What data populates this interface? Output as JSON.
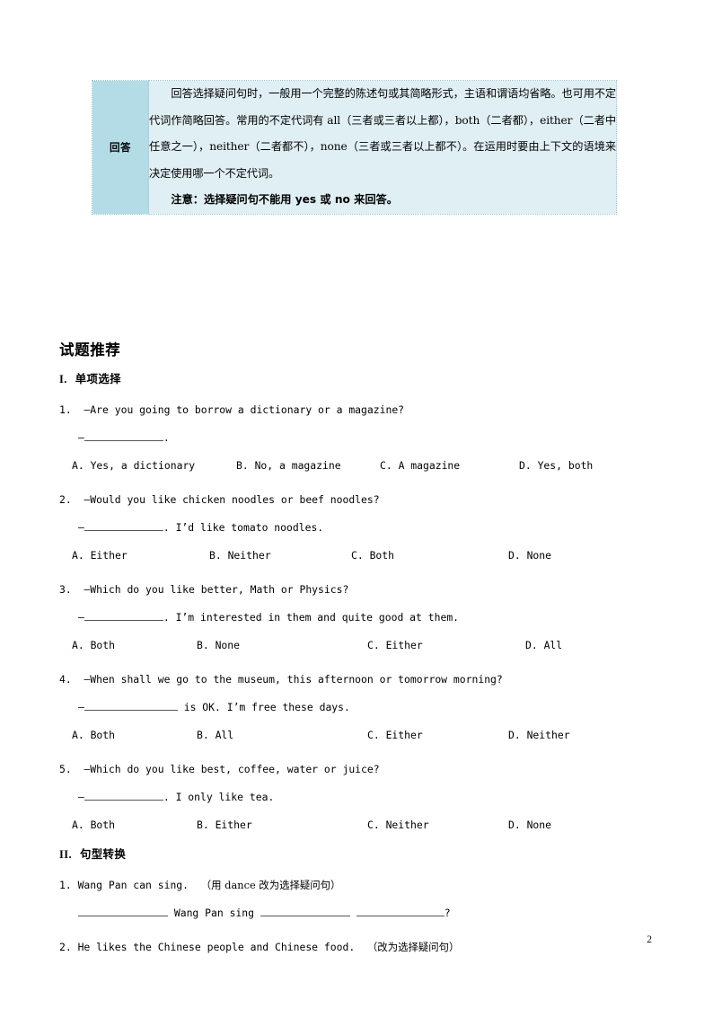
{
  "note_table": {
    "label": "回答",
    "paragraph": "回答选择疑问句时，一般用一个完整的陈述句或其简略形式，主语和谓语均省略。也可用不定代词作简略回答。常用的不定代词有 all（三者或三者以上都），both（二者都），either（二者中任意之一），neither（二者都不），none（三者或三者以上都不）。在运用时要由上下文的语境来决定使用哪一个不定代词。",
    "caution": "注意：选择疑问句不能用 yes 或 no 来回答。",
    "colors": {
      "label_bg": "#b3dce6",
      "body_bg": "#e0eff4",
      "border": "#9cc9d6"
    }
  },
  "main_heading": "试题推荐",
  "part1": {
    "roman": "I.",
    "title": "单项选择",
    "questions": [
      {
        "number": "1.",
        "stem": "—Are you going to borrow a dictionary or a magazine?",
        "answer_prefix": "—",
        "answer_suffix": ".",
        "options": [
          "A. Yes, a dictionary",
          "B. No, a magazine",
          "C. A magazine",
          "D. Yes, both"
        ]
      },
      {
        "number": "2.",
        "stem": "—Would you like chicken noodles or beef noodles?",
        "answer_prefix": "—",
        "answer_suffix": ". I’d like tomato noodles.",
        "options": [
          "A. Either",
          "B. Neither",
          "C. Both",
          "D. None"
        ]
      },
      {
        "number": "3.",
        "stem": "—Which do you like better, Math or Physics?",
        "answer_prefix": "—",
        "answer_suffix": ". I’m interested in them and quite good at them.",
        "options": [
          "A. Both",
          "B. None",
          "C. Either",
          "D. All"
        ]
      },
      {
        "number": "4.",
        "stem": "—When shall we go to the museum, this afternoon or tomorrow morning?",
        "answer_prefix": "—",
        "answer_suffix": " is OK. I’m free these days.",
        "options": [
          "A. Both",
          "B. All",
          "C. Either",
          "D. Neither"
        ]
      },
      {
        "number": "5.",
        "stem": "—Which do you like best, coffee, water or juice?",
        "answer_prefix": "—",
        "answer_suffix": ". I only like tea.",
        "options": [
          "A. Both",
          "B. Either",
          "C. Neither",
          "D. None"
        ]
      }
    ]
  },
  "part2": {
    "roman": "II.",
    "title": "句型转换",
    "questions": [
      {
        "number": "1.",
        "stem": "Wang Pan can sing. ",
        "instruction": "（用 dance 改为选择疑问句）",
        "fill_middle": " Wang Pan sing ",
        "fill_end": "?"
      },
      {
        "number": "2.",
        "stem": "He likes the Chinese people and Chinese food. ",
        "instruction": "（改为选择疑问句）"
      }
    ]
  },
  "page_number": "2"
}
